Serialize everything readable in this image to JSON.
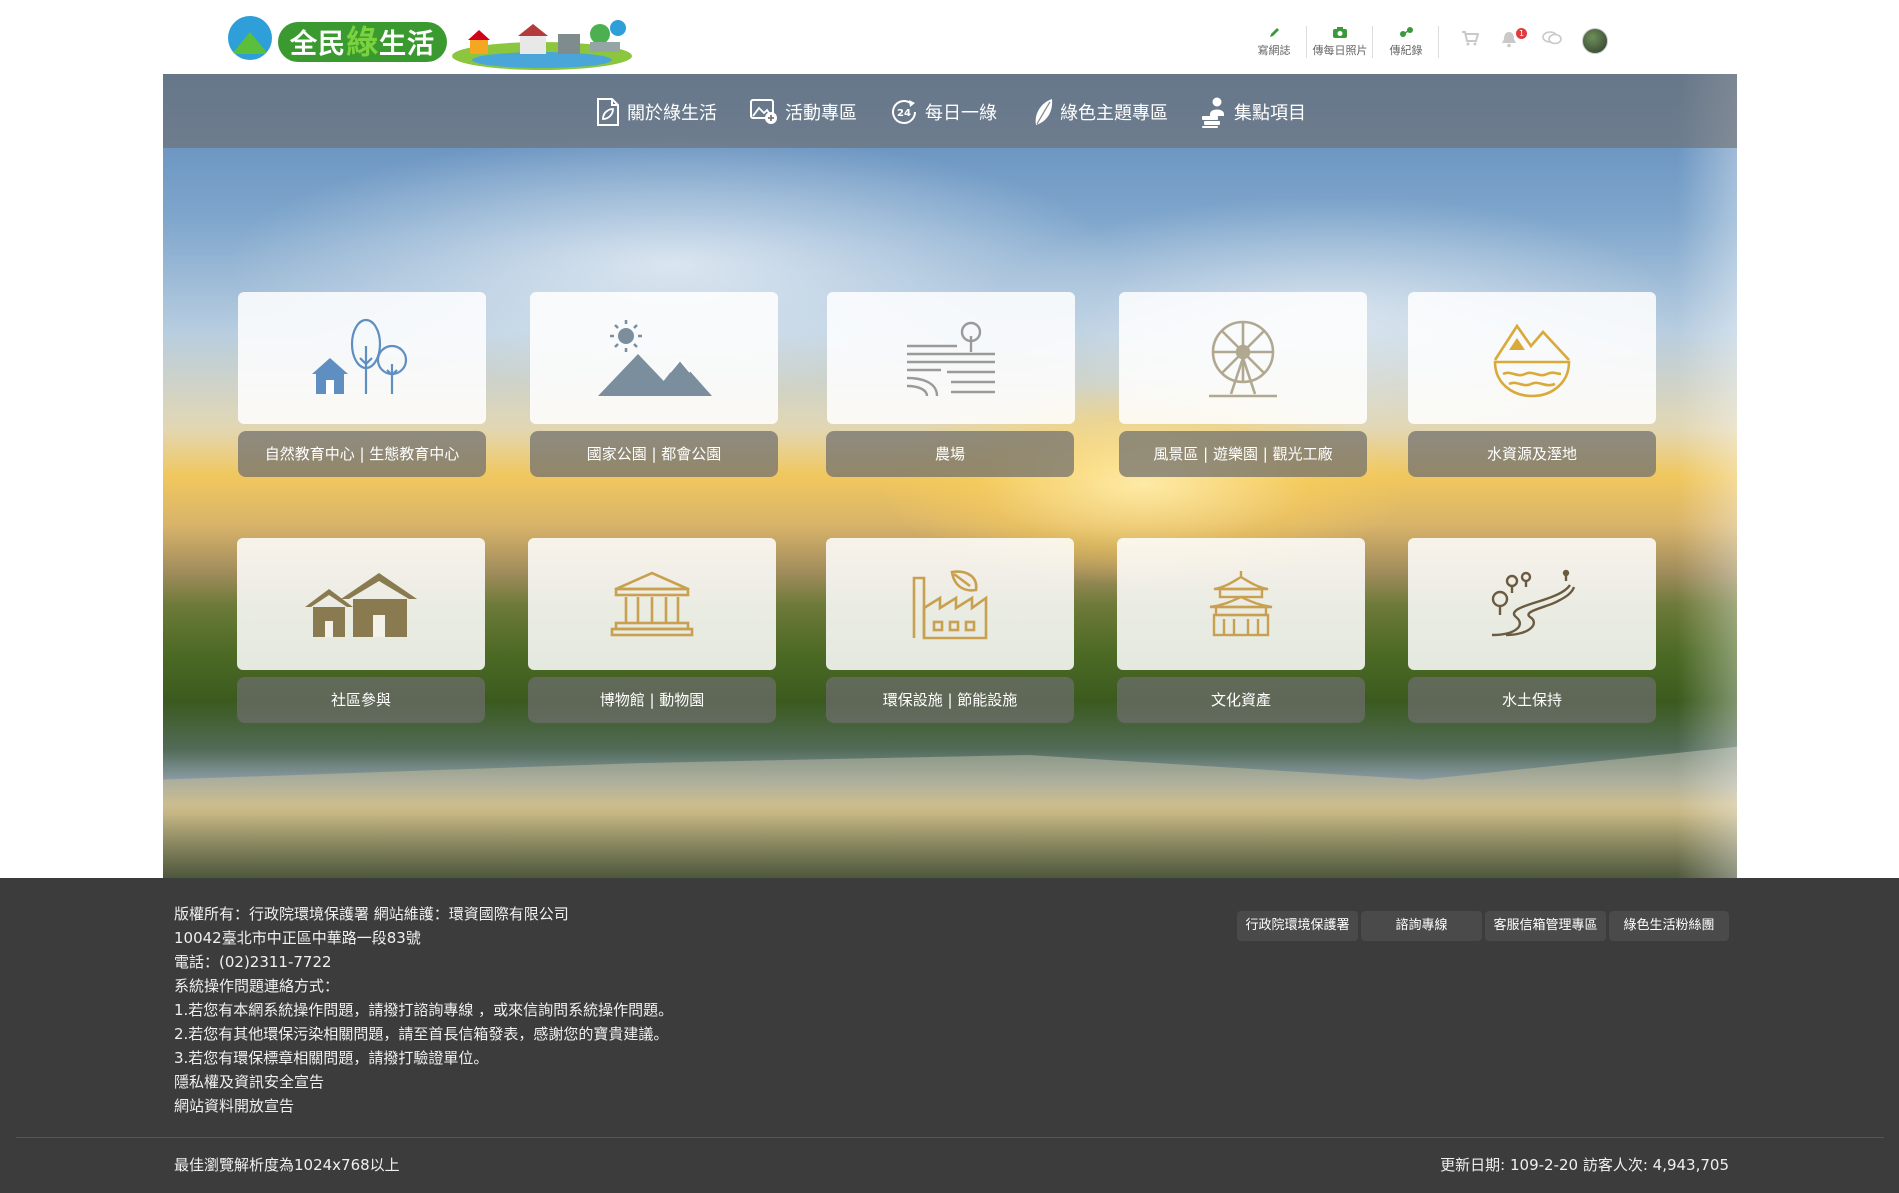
{
  "header": {
    "logo_text_a": "全民",
    "logo_text_b": "綠",
    "logo_text_c": "生活",
    "utilities": [
      {
        "label": "寫網誌",
        "icon": "pencil-icon"
      },
      {
        "label": "傳每日照片",
        "icon": "camera-icon"
      },
      {
        "label": "傳紀錄",
        "icon": "plant-upload-icon"
      }
    ],
    "notification_count": "1"
  },
  "nav": {
    "items": [
      {
        "label": "關於綠生活",
        "icon": "document-leaf-icon"
      },
      {
        "label": "活動專區",
        "icon": "image-plus-icon"
      },
      {
        "label": "每日一綠",
        "icon": "24-hour-icon"
      },
      {
        "label": "綠色主題專區",
        "icon": "leaf-icon"
      },
      {
        "label": "集點項目",
        "icon": "person-stack-icon"
      }
    ]
  },
  "categories": [
    {
      "label": "自然教育中心 | 生態教育中心",
      "icon": "house-trees-icon",
      "color": "#5f8fc0"
    },
    {
      "label": "國家公園 | 都會公園",
      "icon": "mountain-sun-icon",
      "color": "#7a8e9e"
    },
    {
      "label": "農場",
      "icon": "farm-field-icon",
      "color": "#9a9a9a"
    },
    {
      "label": "風景區 | 遊樂園 | 觀光工廠",
      "icon": "ferris-wheel-icon",
      "color": "#b0a890"
    },
    {
      "label": "水資源及溼地",
      "icon": "water-mountain-icon",
      "color": "#d9a93a"
    },
    {
      "label": "社區參與",
      "icon": "houses-icon",
      "color": "#8a7a50"
    },
    {
      "label": "博物館 | 動物園",
      "icon": "museum-icon",
      "color": "#c8a050"
    },
    {
      "label": "環保設施 | 節能設施",
      "icon": "factory-leaf-icon",
      "color": "#c8a050"
    },
    {
      "label": "文化資產",
      "icon": "pagoda-icon",
      "color": "#c8a050"
    },
    {
      "label": "水土保持",
      "icon": "river-trees-icon",
      "color": "#6a5a40"
    }
  ],
  "footer": {
    "lines": [
      "版權所有：行政院環境保護署 網站維護：環資國際有限公司",
      "10042臺北市中正區中華路一段83號",
      "電話：(02)2311-7722",
      "系統操作問題連絡方式：",
      "1.若您有本網系統操作問題，請撥打諮詢專線 ，或來信詢問系統操作問題。",
      "2.若您有其他環保污染相關問題，請至首長信箱發表，感謝您的寶貴建議。",
      "3.若您有環保標章相關問題，請撥打驗證單位。"
    ],
    "links": [
      "隱私權及資訊安全宣告",
      "網站資料開放宣告"
    ],
    "buttons": [
      "行政院環境保護署",
      "諮詢專線",
      "客服信箱管理專區",
      "綠色生活粉絲團"
    ],
    "resolution_note": "最佳瀏覽解析度為1024x768以上",
    "update_info": "更新日期: 109-2-20 訪客人次: 4,943,705"
  }
}
